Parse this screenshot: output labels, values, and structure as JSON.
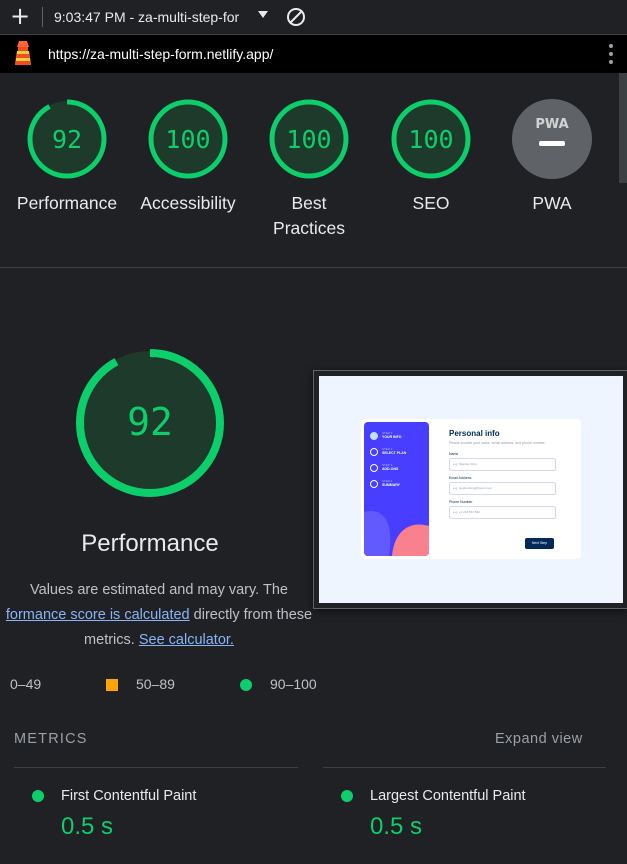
{
  "toolbar": {
    "title": "9:03:47 PM - za-multi-step-for"
  },
  "address": {
    "url": "https://za-multi-step-form.netlify.app/"
  },
  "colors": {
    "pass": "#0cce6b",
    "average": "#ffa400",
    "fail": "#ff4e42",
    "background": "#202124"
  },
  "categories": [
    {
      "label": "Performance",
      "score": "92",
      "value": 92
    },
    {
      "label": "Accessibility",
      "score": "100",
      "value": 100
    },
    {
      "label": "Best Practices",
      "score": "100",
      "value": 100
    },
    {
      "label": "SEO",
      "score": "100",
      "value": 100
    },
    {
      "label": "PWA",
      "badge": "PWA"
    }
  ],
  "performance": {
    "score": "92",
    "value": 92,
    "title": "Performance",
    "desc_1": "Values are estimated and may vary. The",
    "desc_link_1": "formance score is calculated",
    "desc_2": "directly from these metrics.",
    "desc_link_2": "See calculator."
  },
  "legend": {
    "fail": "0–49",
    "average": "50–89",
    "pass": "90–100"
  },
  "screenshot": {
    "title": "Personal info",
    "subtitle": "Please provide your name, email address, and phone number.",
    "steps": [
      {
        "small": "STEP 1",
        "label": "YOUR INFO"
      },
      {
        "small": "STEP 2",
        "label": "SELECT PLAN"
      },
      {
        "small": "STEP 3",
        "label": "ADD-ONS"
      },
      {
        "small": "STEP 4",
        "label": "SUMMARY"
      }
    ],
    "fields": [
      {
        "label": "Name",
        "placeholder": "e.g. Stephen King"
      },
      {
        "label": "Email Address",
        "placeholder": "e.g. stephenking@lorem.com"
      },
      {
        "label": "Phone Number",
        "placeholder": "e.g. +1 234 567 890"
      }
    ],
    "button": "Next Step"
  },
  "metrics": {
    "heading": "METRICS",
    "expand": "Expand view",
    "items": [
      {
        "name": "First Contentful Paint",
        "value": "0.5 s"
      },
      {
        "name": "Largest Contentful Paint",
        "value": "0.5 s"
      }
    ]
  }
}
